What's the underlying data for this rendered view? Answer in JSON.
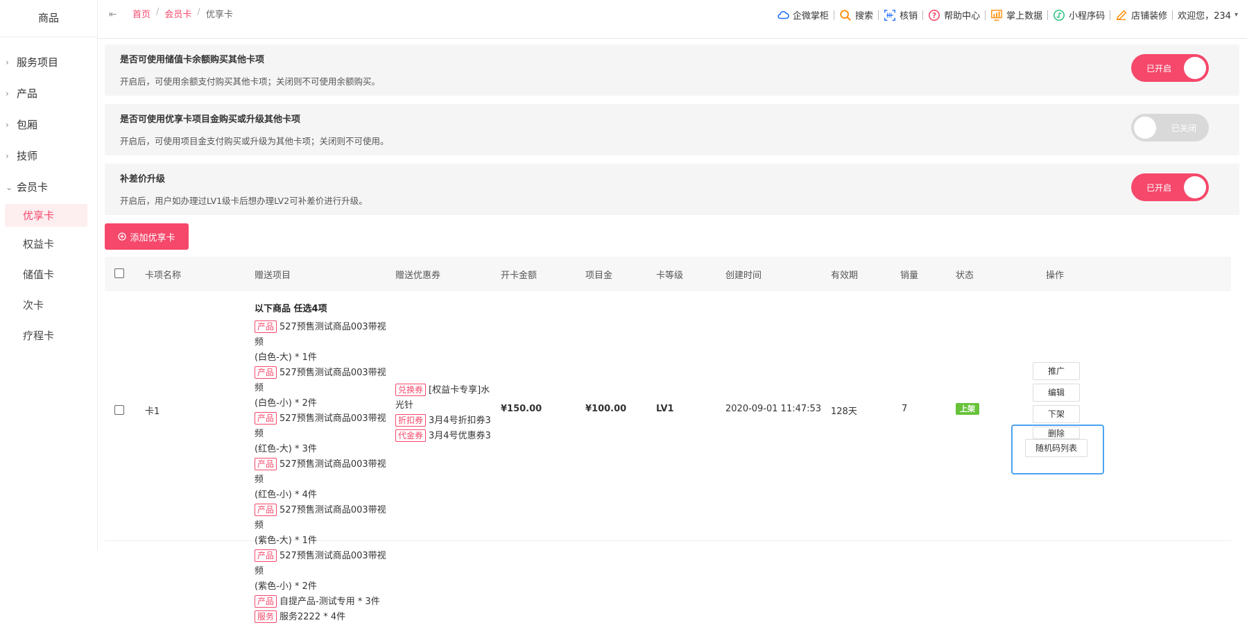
{
  "sidebar": {
    "title": "商品",
    "groups": [
      {
        "label": "服务项目",
        "chevron": "›"
      },
      {
        "label": "产品",
        "chevron": "›"
      },
      {
        "label": "包厢",
        "chevron": "›"
      },
      {
        "label": "技师",
        "chevron": "›"
      },
      {
        "label": "会员卡",
        "chevron": "⌄"
      }
    ],
    "subs": [
      "优享卡",
      "权益卡",
      "储值卡",
      "次卡",
      "疗程卡"
    ]
  },
  "header": {
    "breadcrumb": [
      "首页",
      "会员卡",
      "优享卡"
    ],
    "tools": [
      {
        "label": "企微掌柜",
        "icon": "cloud-icon",
        "color": "#1e6fff"
      },
      {
        "label": "搜索",
        "icon": "search-icon",
        "color": "#ff8a00"
      },
      {
        "label": "核销",
        "icon": "scan-icon",
        "color": "#1e6fff"
      },
      {
        "label": "帮助中心",
        "icon": "help-icon",
        "color": "#f5486b"
      },
      {
        "label": "掌上数据",
        "icon": "chart-icon",
        "color": "#ff8a00"
      },
      {
        "label": "小程序码",
        "icon": "miniprogram-icon",
        "color": "#1fbf7a"
      },
      {
        "label": "店铺装修",
        "icon": "paint-icon",
        "color": "#ff8a00"
      }
    ],
    "welcome": "欢迎您，234",
    "welcome_caret": "▾"
  },
  "settings": [
    {
      "title": "是否可使用储值卡余额购买其他卡项",
      "desc": "开启后，可使用余额支付购买其他卡项；关闭则不可使用余额购买。",
      "state": "已开启",
      "on": true
    },
    {
      "title": "是否可使用优享卡项目金购买或升级其他卡项",
      "desc": "开启后，可使用项目金支付购买或升级为其他卡项；关闭则不可使用。",
      "state": "已关闭",
      "on": false
    },
    {
      "title": "补差价升级",
      "desc": "开启后，用户如办理过LV1级卡后想办理LV2可补差价进行升级。",
      "state": "已开启",
      "on": true
    }
  ],
  "add_button": "添加优享卡",
  "table": {
    "headers": [
      "卡项名称",
      "赠送项目",
      "赠送优惠券",
      "开卡金额",
      "项目金",
      "卡等级",
      "创建时间",
      "有效期",
      "销量",
      "状态",
      "操作"
    ],
    "row": {
      "name": "卡1",
      "gift_head": "以下商品 任选4项",
      "gifts": [
        {
          "tag": "产品",
          "text": "527预售测试商品003带视频",
          "cont": "(白色-大) * 1件"
        },
        {
          "tag": "产品",
          "text": "527预售测试商品003带视频",
          "cont": "(白色-小) * 2件"
        },
        {
          "tag": "产品",
          "text": "527预售测试商品003带视频",
          "cont": "(红色-大) * 3件"
        },
        {
          "tag": "产品",
          "text": "527预售测试商品003带视频",
          "cont": "(红色-小) * 4件"
        },
        {
          "tag": "产品",
          "text": "527预售测试商品003带视频",
          "cont": "(紫色-大) * 1件"
        },
        {
          "tag": "产品",
          "text": "527预售测试商品003带视频",
          "cont": "(紫色-小) * 2件"
        },
        {
          "tag": "产品",
          "text": "自提产品-测试专用 * 3件",
          "cont": ""
        },
        {
          "tag": "服务",
          "text": "服务2222 * 4件",
          "cont": ""
        }
      ],
      "coupons": [
        {
          "tag": "兑换券",
          "text": "[权益卡专享]水",
          "cont": "光针"
        },
        {
          "tag": "折扣券",
          "text": "3月4号折扣券3",
          "cont": ""
        },
        {
          "tag": "代金券",
          "text": "3月4号优惠券3",
          "cont": ""
        }
      ],
      "amount": "¥150.00",
      "project_gold": "¥100.00",
      "level": "LV1",
      "created": "2020-09-01 11:47:53",
      "validity": "128天",
      "sales": "7",
      "status": "上架",
      "ops": [
        "推广",
        "编辑",
        "下架",
        "删除",
        "随机码列表"
      ]
    }
  }
}
